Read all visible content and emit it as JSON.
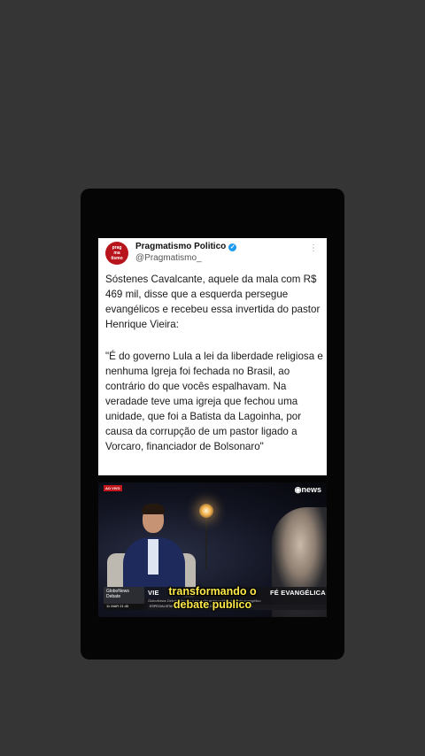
{
  "tweet": {
    "avatar_text": "prag ma tismo",
    "display_name": "Pragmatismo Politico",
    "verified_glyph": "✓",
    "handle": "@Pragmatismo_",
    "more_glyph": "⋮",
    "paragraph1": "Sóstenes Cavalcante, aquele da mala com R$ 469 mil, disse que a esquerda persegue evangélicos e recebeu essa invertida do pastor Henrique Vieira:",
    "paragraph2": "\"É do governo Lula a lei da liberdade religiosa e nenhuma Igreja foi fechada no Brasil, ao contrário do que vocês espalhavam. Na veradade teve uma igreja que fechou uma unidade, que foi a Batista da Lagoinha, por causa da corrupção de um pastor ligado a Vorcaro, financiador de Bolsonaro\""
  },
  "video": {
    "live_badge": "AO VIVO",
    "channel_logo": "◉news",
    "show_name": "GloboNews Debate",
    "date": "11 MAR 21:40",
    "lower_title_left": "VIE",
    "lower_title_right": "FÉ EVANGÉLICA",
    "lower_subtitle": "GloboNews Debate discute a conexão entre política e o voto evangélico",
    "ticker": "ESPECIALISTAS DIZEM QUE PODERES DO BRASIL ESTÃO EM ALTA",
    "caption_line1": "transformando o",
    "caption_line2": "debate publico"
  },
  "colors": {
    "background": "#353535",
    "card": "#050505",
    "tweet_bg": "#ffffff",
    "verified": "#1d9bf0",
    "caption": "#ffe94a"
  }
}
